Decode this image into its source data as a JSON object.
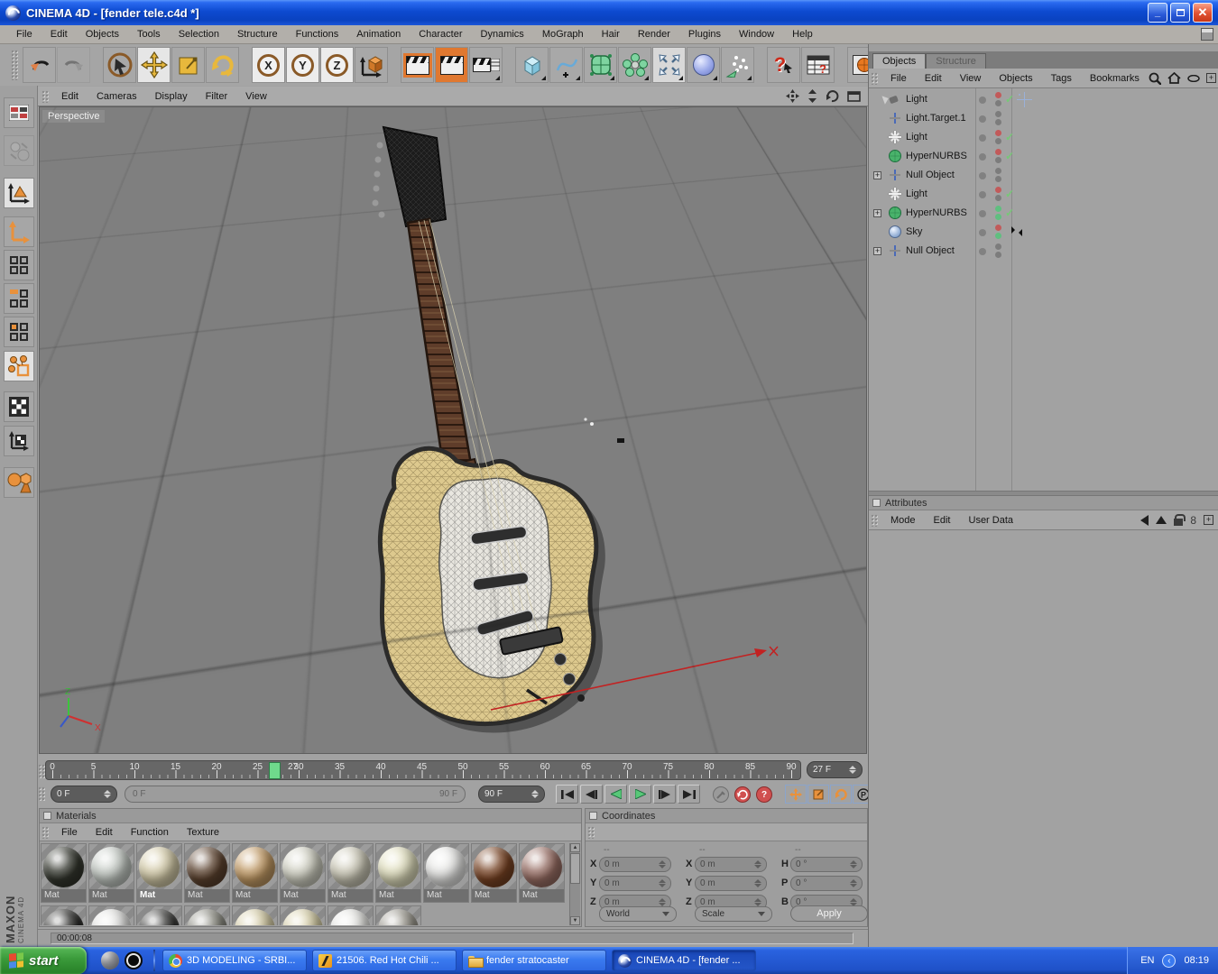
{
  "window": {
    "title": "CINEMA 4D - [fender tele.c4d *]"
  },
  "menubar": {
    "items": [
      "File",
      "Edit",
      "Objects",
      "Tools",
      "Selection",
      "Structure",
      "Functions",
      "Animation",
      "Character",
      "Dynamics",
      "MoGraph",
      "Hair",
      "Render",
      "Plugins",
      "Window",
      "Help"
    ]
  },
  "viewport": {
    "menu": [
      "Edit",
      "Cameras",
      "Display",
      "Filter",
      "View"
    ],
    "camera_label": "Perspective",
    "axis_z_label": "Z",
    "axis_x_label": "X"
  },
  "object_manager": {
    "tabs": [
      {
        "label": "Objects"
      },
      {
        "label": "Structure"
      }
    ],
    "menu": [
      "File",
      "Edit",
      "View",
      "Objects",
      "Tags",
      "Bookmarks"
    ],
    "objects": [
      {
        "name": "Light",
        "dots": [
          "red",
          "gray"
        ],
        "check": true,
        "tag": "target"
      },
      {
        "name": "Light.Target.1",
        "dots": [
          "gray",
          "gray"
        ],
        "check": false,
        "tag": null
      },
      {
        "name": "Light",
        "dots": [
          "red",
          "gray"
        ],
        "check": true,
        "tag": null
      },
      {
        "name": "HyperNURBS",
        "dots": [
          "red",
          "gray"
        ],
        "check": true,
        "tag": null
      },
      {
        "name": "Null Object",
        "dots": [
          "gray",
          "gray"
        ],
        "check": false,
        "tag": null
      },
      {
        "name": "Light",
        "dots": [
          "red",
          "gray"
        ],
        "check": true,
        "tag": null
      },
      {
        "name": "HyperNURBS",
        "dots": [
          "green",
          "green"
        ],
        "check": true,
        "tag": null
      },
      {
        "name": "Sky",
        "dots": [
          "red",
          "green"
        ],
        "check": false,
        "tag": "texture"
      },
      {
        "name": "Null Object",
        "dots": [
          "gray",
          "gray"
        ],
        "check": false,
        "tag": null
      }
    ]
  },
  "attributes_panel": {
    "title": "Attributes",
    "menu": [
      "Mode",
      "Edit",
      "User Data"
    ]
  },
  "timeline": {
    "ticks": [
      0,
      5,
      10,
      15,
      20,
      25,
      30,
      35,
      40,
      45,
      50,
      55,
      60,
      65,
      70,
      75,
      80,
      85,
      90
    ],
    "current_frame_label": "27",
    "frame_field": "27 F",
    "start_field": "0 F",
    "end_field": "90 F",
    "range_start_label": "0 F",
    "range_end_label": "90 F"
  },
  "materials_panel": {
    "title": "Materials",
    "menu": [
      "File",
      "Edit",
      "Function",
      "Texture"
    ],
    "items": [
      {
        "label": "Mat",
        "color": "#35382f",
        "selected": false
      },
      {
        "label": "Mat",
        "color": "#c6ccc6",
        "selected": false
      },
      {
        "label": "Mat",
        "color": "#d6cdaa",
        "selected": true
      },
      {
        "label": "Mat",
        "color": "#5e4430",
        "selected": false
      },
      {
        "label": "Mat",
        "color": "#c49c66",
        "selected": false
      },
      {
        "label": "Mat",
        "color": "#d2d2c4",
        "selected": false
      },
      {
        "label": "Mat",
        "color": "#cdcab8",
        "selected": false
      },
      {
        "label": "Mat",
        "color": "#e2e0bf",
        "selected": false
      },
      {
        "label": "Mat",
        "color": "#e8e8e6",
        "selected": false
      },
      {
        "label": "Mat",
        "color": "#7a4424",
        "selected": false
      },
      {
        "label": "Mat",
        "color": "#9b7066",
        "selected": false
      }
    ],
    "partial_row_colors": [
      "#2c2c2a",
      "#e2e2e0",
      "#3a3a38",
      "#8a8a80",
      "#d6cda6",
      "#d8d0a8",
      "#e6e6e2",
      "#99968c"
    ]
  },
  "coordinates_panel": {
    "title": "Coordinates",
    "column_headers": [
      "--",
      "--",
      "--"
    ],
    "position": {
      "rows": [
        {
          "label": "X",
          "value": "0 m"
        },
        {
          "label": "Y",
          "value": "0 m"
        },
        {
          "label": "Z",
          "value": "0 m"
        }
      ]
    },
    "scale": {
      "rows": [
        {
          "label": "X",
          "value": "0 m"
        },
        {
          "label": "Y",
          "value": "0 m"
        },
        {
          "label": "Z",
          "value": "0 m"
        }
      ]
    },
    "rotation": {
      "rows": [
        {
          "label": "H",
          "value": "0 °"
        },
        {
          "label": "P",
          "value": "0 °"
        },
        {
          "label": "B",
          "value": "0 °"
        }
      ]
    },
    "space_dropdown": "World",
    "mode_dropdown": "Scale",
    "apply_label": "Apply"
  },
  "status_bar": {
    "time_counter": "00:00:08"
  },
  "branding": {
    "line1": "MAXON",
    "line2": "CINEMA 4D"
  },
  "taskbar": {
    "start_label": "start",
    "tasks": [
      {
        "label": "3D MODELING - SRBI...",
        "icon": "chrome"
      },
      {
        "label": "21506. Red Hot Chili ...",
        "icon": "winamp"
      },
      {
        "label": "fender stratocaster",
        "icon": "folder"
      },
      {
        "label": "CINEMA 4D - [fender ...",
        "icon": "cinema4d",
        "active": true
      }
    ],
    "tray": {
      "language": "EN",
      "time": "08:19"
    }
  }
}
